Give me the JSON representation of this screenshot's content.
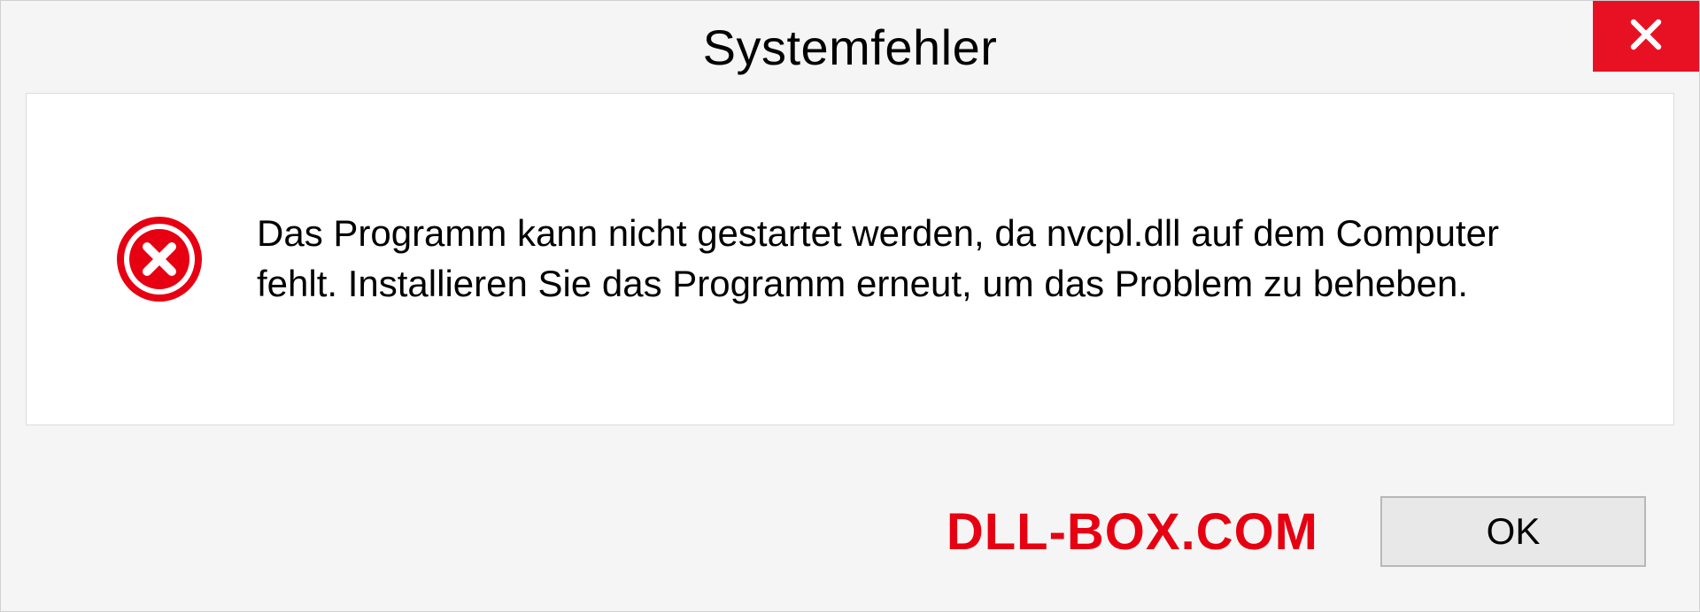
{
  "dialog": {
    "title": "Systemfehler",
    "message": "Das Programm kann nicht gestartet werden, da nvcpl.dll auf dem Computer fehlt. Installieren Sie das Programm erneut, um das Problem zu beheben.",
    "ok_label": "OK"
  },
  "watermark": "DLL-BOX.COM"
}
